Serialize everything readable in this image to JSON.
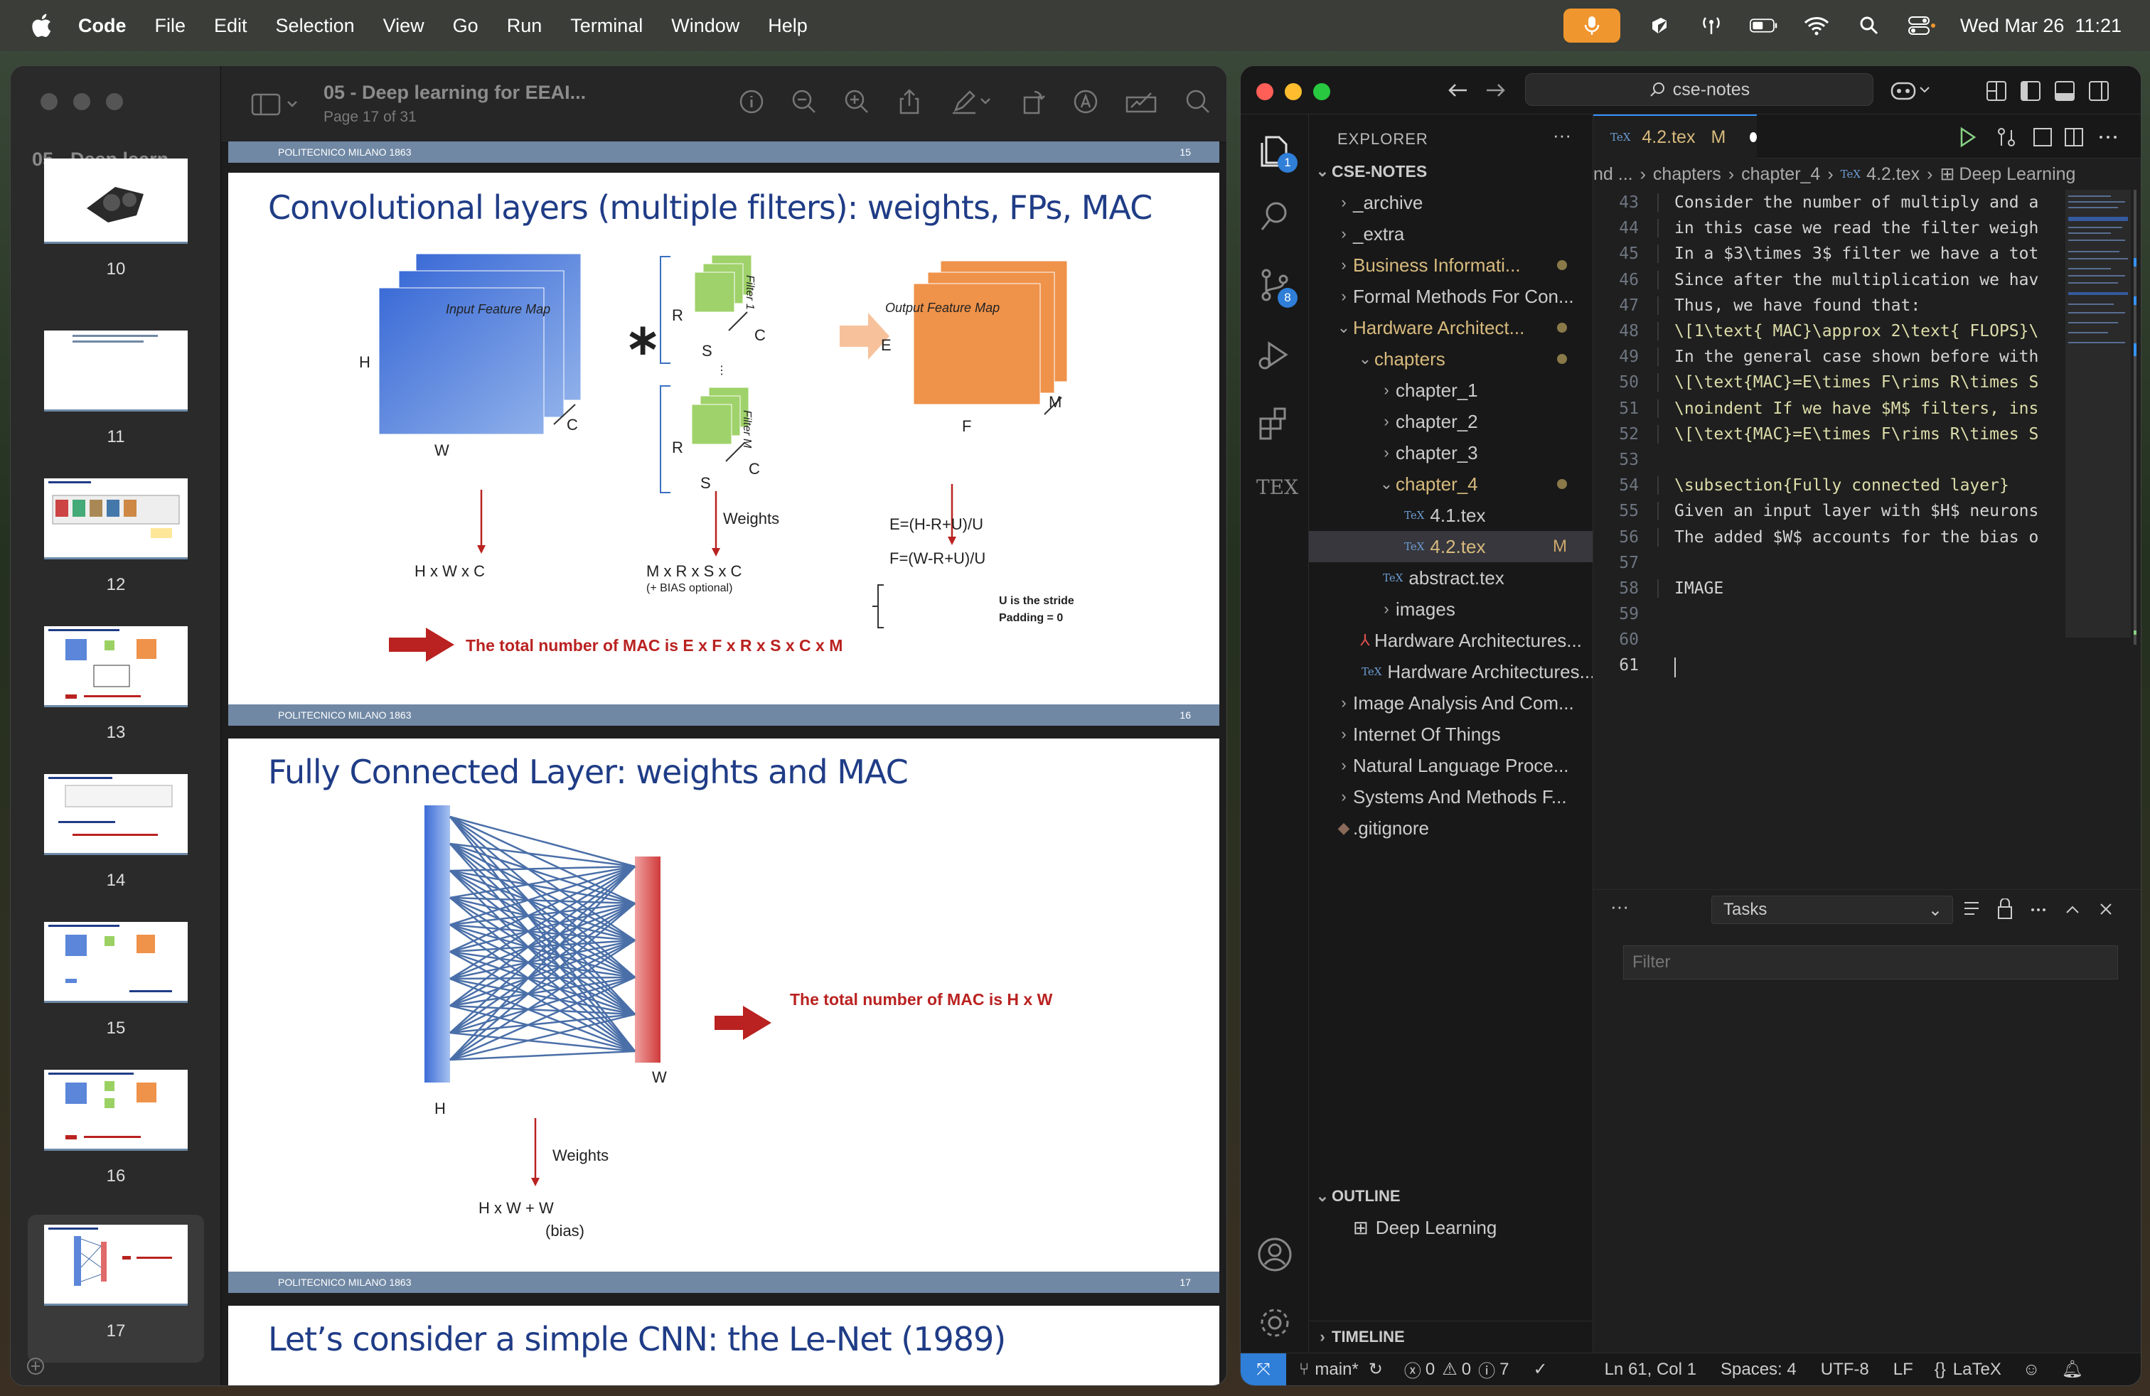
{
  "menubar": {
    "app": "Code",
    "items": [
      "File",
      "Edit",
      "Selection",
      "View",
      "Go",
      "Run",
      "Terminal",
      "Window",
      "Help"
    ],
    "clock": "Wed Mar 26  11:21"
  },
  "preview": {
    "sidebar_title": "05 - Deep learn...",
    "doc_title": "05 - Deep learning for EEAI...",
    "page_info": "Page 17 of 31",
    "thumbs": [
      "10",
      "11",
      "12",
      "13",
      "14",
      "15",
      "16",
      "17"
    ],
    "slide15_num": "15",
    "slide16": {
      "header": "POLITECNICO MILANO 1863",
      "num": "16",
      "title": "Convolutional layers (multiple filters): weights, FPs, MAC",
      "input_map": "Input Feature Map",
      "output_map": "Output Feature Map",
      "H": "H",
      "W": "W",
      "C": "C",
      "R": "R",
      "S": "S",
      "E": "E",
      "F": "F",
      "M": "M",
      "filter1": "Filter 1",
      "filterM": "Filter M",
      "input_dims": "H x W x C",
      "weights": "Weights",
      "weights_dims": "M x R x S x C",
      "bias_opt": "(+ BIAS optional)",
      "eq1": "E=(H-R+U)/U",
      "eq2": "F=(W-R+U)/U",
      "stride": "U is the stride",
      "padding": "Padding = 0",
      "mac": "The total number of MAC is E x F x R x S x C x M"
    },
    "slide17": {
      "header": "POLITECNICO MILANO 1863",
      "num": "17",
      "title": "Fully Connected Layer: weights and MAC",
      "H": "H",
      "W": "W",
      "weights": "Weights",
      "dims": "H x W + W",
      "bias": "(bias)",
      "mac": "The total number of MAC is H x W"
    },
    "slide18_title": "Let’s consider a simple CNN: the Le-Net (1989)"
  },
  "vscode": {
    "search": "cse-notes",
    "explorer_title": "EXPLORER",
    "root": "CSE-NOTES",
    "tree": [
      {
        "label": "_archive",
        "indent": 1,
        "chev": "›"
      },
      {
        "label": "_extra",
        "indent": 1,
        "chev": "›"
      },
      {
        "label": "Business Informati...",
        "indent": 1,
        "chev": "›",
        "mod": true,
        "dot": true
      },
      {
        "label": "Formal Methods For Con...",
        "indent": 1,
        "chev": "›"
      },
      {
        "label": "Hardware Architect...",
        "indent": 1,
        "chev": "⌄",
        "mod": true,
        "dot": true
      },
      {
        "label": "chapters",
        "indent": 2,
        "chev": "⌄",
        "mod": true,
        "dot": true
      },
      {
        "label": "chapter_1",
        "indent": 3,
        "chev": "›"
      },
      {
        "label": "chapter_2",
        "indent": 3,
        "chev": "›"
      },
      {
        "label": "chapter_3",
        "indent": 3,
        "chev": "›"
      },
      {
        "label": "chapter_4",
        "indent": 3,
        "chev": "⌄",
        "mod": true,
        "dot": true
      },
      {
        "label": "4.1.tex",
        "indent": 4,
        "tex": true
      },
      {
        "label": "4.2.tex",
        "indent": 4,
        "tex": true,
        "mod": true,
        "m": "M",
        "sel": true
      },
      {
        "label": "abstract.tex",
        "indent": 3,
        "tex": true
      },
      {
        "label": "images",
        "indent": 3,
        "chev": "›"
      },
      {
        "label": "Hardware Architectures...",
        "indent": 2,
        "pdf": true
      },
      {
        "label": "Hardware Architectures...",
        "indent": 2,
        "tex": true
      },
      {
        "label": "Image Analysis And Com...",
        "indent": 1,
        "chev": "›"
      },
      {
        "label": "Internet Of Things",
        "indent": 1,
        "chev": "›"
      },
      {
        "label": "Natural Language Proce...",
        "indent": 1,
        "chev": "›"
      },
      {
        "label": "Systems And Methods F...",
        "indent": 1,
        "chev": "›"
      },
      {
        "label": ".gitignore",
        "indent": 1,
        "git": true
      }
    ],
    "outline_title": "OUTLINE",
    "outline_item": "Deep Learning",
    "timeline_title": "TIMELINE",
    "tab_label": "4.2.tex",
    "tab_mod": "M",
    "breadcrumb": [
      "nd ...",
      "chapters",
      "chapter_4",
      "4.2.tex",
      "Deep Learning"
    ],
    "code_lines": [
      {
        "n": "43",
        "t": "Consider the number of multiply and a"
      },
      {
        "n": "44",
        "t": "in this case we read the filter weigh"
      },
      {
        "n": "45",
        "t": "In a $3\\times 3$ filter we have a tot"
      },
      {
        "n": "46",
        "t": "Since after the multiplication we hav"
      },
      {
        "n": "47",
        "t": "Thus, we have found that:"
      },
      {
        "n": "48",
        "t": "\\[1\\text{ MAC}\\approx 2\\text{ FLOPS}\\"
      },
      {
        "n": "49",
        "t": "In the general case shown before with"
      },
      {
        "n": "50",
        "t": "\\[\\text{MAC}=E\\times F\\rims R\\times S"
      },
      {
        "n": "51",
        "t": "\\noindent If we have $M$ filters, ins"
      },
      {
        "n": "52",
        "t": "\\[\\text{MAC}=E\\times F\\rims R\\times S"
      },
      {
        "n": "53",
        "t": ""
      },
      {
        "n": "54",
        "t": "\\subsection{Fully connected layer}"
      },
      {
        "n": "55",
        "t": "Given an input layer with $H$ neurons"
      },
      {
        "n": "56",
        "t": "The added $W$ accounts for the bias o"
      },
      {
        "n": "57",
        "t": ""
      },
      {
        "n": "58",
        "t": "IMAGE"
      },
      {
        "n": "59",
        "t": ""
      },
      {
        "n": "60",
        "t": ""
      },
      {
        "n": "61",
        "t": ""
      }
    ],
    "panel_select": "Tasks",
    "filter_placeholder": "Filter",
    "status": {
      "branch": "main*",
      "errors": "0",
      "warnings": "0",
      "infos": "7",
      "position": "Ln 61, Col 1",
      "spaces": "Spaces: 4",
      "encoding": "UTF-8",
      "eol": "LF",
      "lang": "LaTeX"
    },
    "badges": {
      "explorer": "1",
      "scm": "8"
    }
  },
  "colors": {
    "accent": "#3794ff",
    "preview_bar": "#7088a4",
    "slide_title": "#1f3c86",
    "mac_red": "#b92220",
    "mic": "#f0962e"
  }
}
